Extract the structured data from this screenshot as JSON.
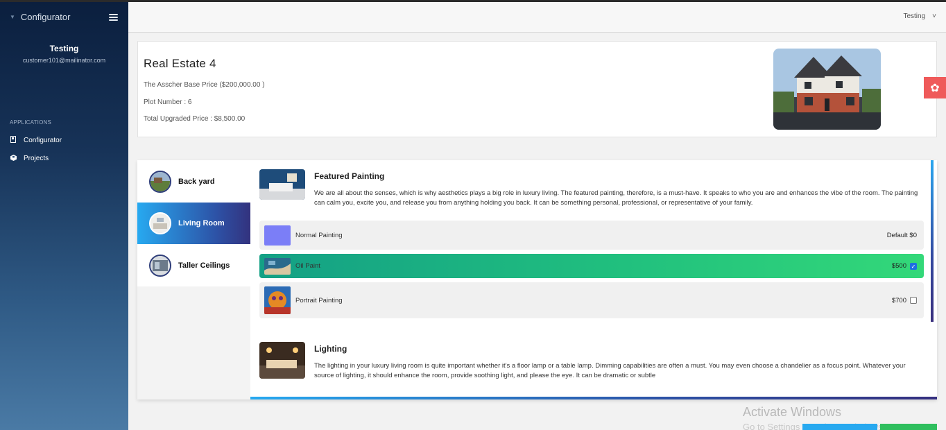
{
  "sidebar": {
    "brand": "Configurator",
    "user_name": "Testing",
    "user_email": "customer101@mailinator.com",
    "section_label": "APPLICATIONS",
    "items": [
      {
        "label": "Configurator",
        "icon": "book-icon"
      },
      {
        "label": "Projects",
        "icon": "cube-icon"
      }
    ]
  },
  "topbar": {
    "user_label": "Testing",
    "chevron": "˅"
  },
  "summary": {
    "title": "Real Estate 4",
    "base_price": "The Asscher Base Price ($200,000.00 )",
    "plot": "Plot Number : 6",
    "total": "Total Upgraded Price : $8,500.00"
  },
  "rooms": [
    {
      "label": "Back yard",
      "active": false
    },
    {
      "label": "Living Room",
      "active": true
    },
    {
      "label": "Taller Ceilings",
      "active": false
    }
  ],
  "featured": {
    "title": "Featured Painting",
    "description": "We are all about the senses, which is why aesthetics plays a big role in luxury living. The featured painting, therefore, is a must-have. It speaks to who you are and enhances the vibe of the room. The painting can calm you, excite you, and release you from anything holding you back. It can be something personal, professional, or representative of your family.",
    "options": [
      {
        "name": "Normal Painting",
        "price": "Default $0",
        "selected": false,
        "swatch_color": "#7b7ef7"
      },
      {
        "name": "Oil Paint",
        "price": "$500",
        "selected": true
      },
      {
        "name": "Portrait Painting",
        "price": "$700",
        "selected": false
      }
    ]
  },
  "lighting": {
    "title": "Lighting",
    "description": "The lighting in your luxury living room is quite important whether it's a floor lamp or a table lamp. Dimming capabilities are often a must. You may even choose a chandelier as a focus point. Whatever your source of lighting, it should enhance the room, provide soothing light, and please the eye. It can be dramatic or subtle"
  },
  "watermark": {
    "line1": "Activate Windows",
    "line2": "Go to Settings to activate Windows."
  },
  "colors": {
    "accent_gradient_start": "#27a9f0",
    "accent_gradient_end": "#33327e",
    "selected_green": "#21c07e",
    "gear_red": "#ef5a5a"
  }
}
